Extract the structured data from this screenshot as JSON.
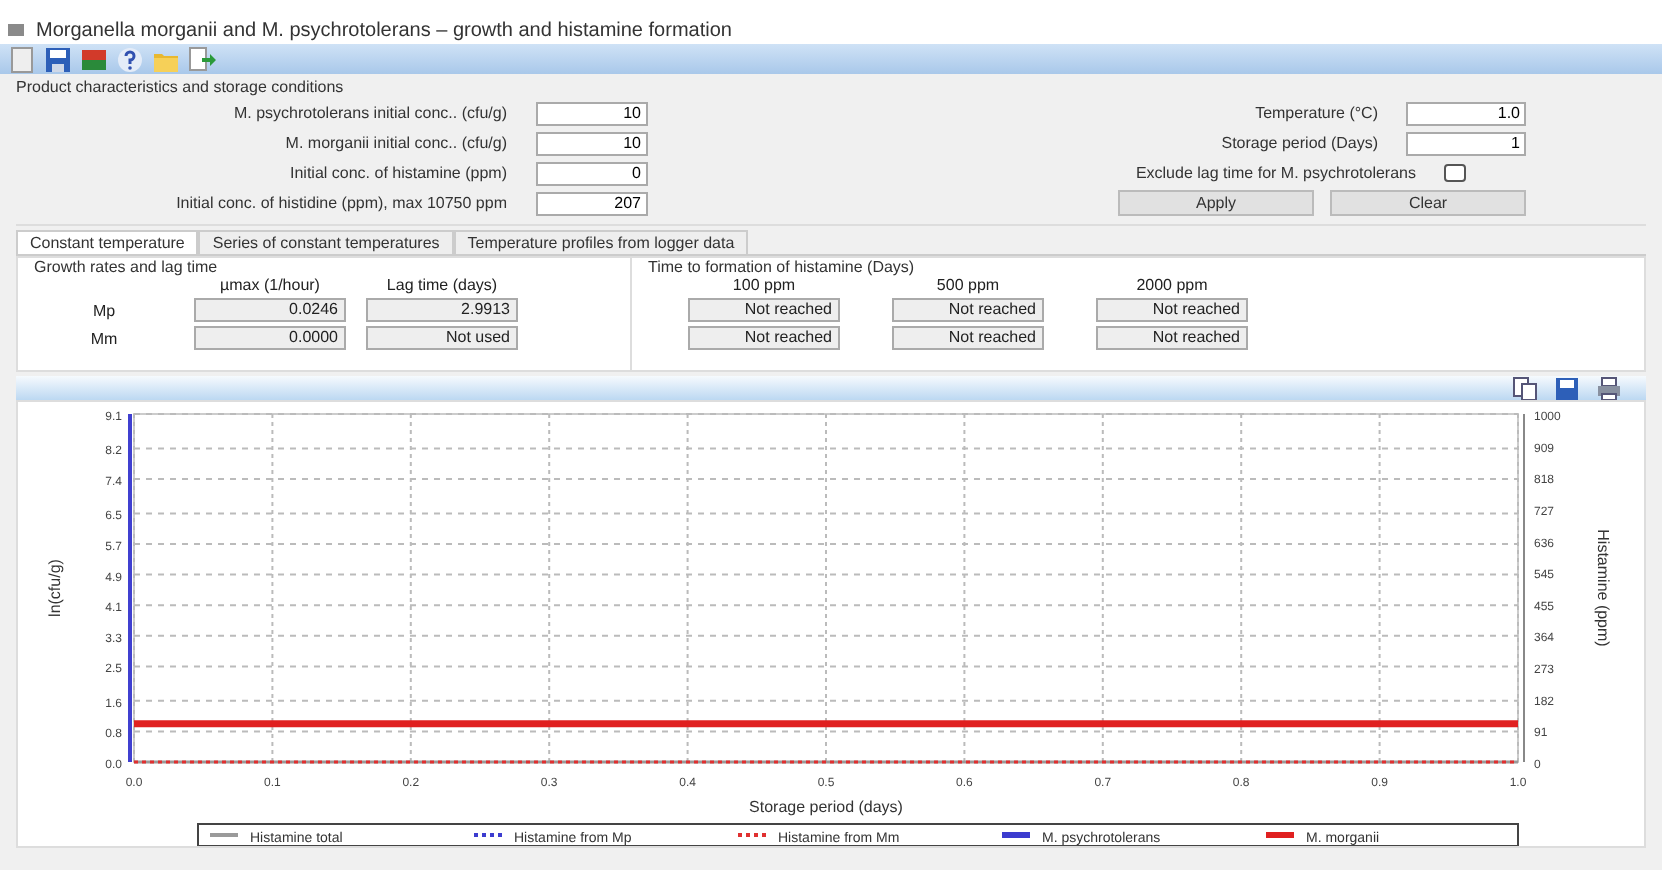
{
  "window": {
    "title": "Morganella morganii and M. psychrotolerans – growth and histamine formation"
  },
  "product_group": {
    "title": "Product characteristics and storage conditions",
    "left_fields": [
      {
        "label": "M. psychrotolerans initial conc.. (cfu/g)",
        "value": "10"
      },
      {
        "label": "M. morganii initial conc.. (cfu/g)",
        "value": "10"
      },
      {
        "label": "Initial conc. of histamine (ppm)",
        "value": "0"
      },
      {
        "label": "Initial conc. of histidine (ppm), max 10750 ppm",
        "value": "207"
      }
    ],
    "right_fields": [
      {
        "label": "Temperature (°C)",
        "value": "1.0"
      },
      {
        "label": "Storage period (Days)",
        "value": "1"
      }
    ],
    "checkbox": {
      "label": "Exclude lag time for M. psychrotolerans",
      "checked": false
    },
    "buttons": [
      "Apply",
      "Clear"
    ]
  },
  "tabs": [
    {
      "label": "Constant temperature",
      "selected": true
    },
    {
      "label": "Series of constant temperatures",
      "selected": false
    },
    {
      "label": "Temperature profiles from logger data",
      "selected": false
    }
  ],
  "growth": {
    "title": "Growth rates and lag time",
    "columns": [
      "µmax (1/hour)",
      "Lag time (days)"
    ],
    "rows": [
      {
        "label": "Mp",
        "values": [
          "0.0246",
          "2.9913"
        ]
      },
      {
        "label": "Mm",
        "values": [
          "0.0000",
          "Not used"
        ]
      }
    ]
  },
  "histamine_time": {
    "title": "Time to formation of histamine  (Days)",
    "columns": [
      "100 ppm",
      "500 ppm",
      "2000 ppm"
    ],
    "rows": [
      [
        "Not reached",
        "Not reached",
        "Not reached"
      ],
      [
        "Not reached",
        "Not reached",
        "Not reached"
      ]
    ]
  },
  "histamine_axis": {
    "title": "Histamine (ppm)",
    "ticks": [
      "1000",
      "909",
      "818",
      "727",
      "636",
      "545",
      "455",
      "364",
      "273",
      "182",
      "91",
      "0"
    ]
  },
  "chart_data": {
    "type": "line",
    "xlabel": "Storage period (days)",
    "ylabel": "ln(cfu/g)",
    "x": [
      0,
      1
    ],
    "xlim": [
      0,
      1
    ],
    "ylim": [
      0,
      9.1
    ],
    "grid": true,
    "legend": true,
    "xticks": [
      {
        "value": 0,
        "label": "0.0"
      },
      {
        "value": 0.1,
        "label": "0.1"
      },
      {
        "value": 0.2,
        "label": "0.2"
      },
      {
        "value": 0.3,
        "label": "0.3"
      },
      {
        "value": 0.4,
        "label": "0.4"
      },
      {
        "value": 0.5,
        "label": "0.5"
      },
      {
        "value": 0.6,
        "label": "0.6"
      },
      {
        "value": 0.7,
        "label": "0.7"
      },
      {
        "value": 0.8,
        "label": "0.8"
      },
      {
        "value": 0.9,
        "label": "0.9"
      },
      {
        "value": 1,
        "label": "1.0"
      }
    ],
    "yticks": [
      {
        "value": 0,
        "label": "0.0"
      },
      0.8,
      1.6,
      2.5,
      3.3,
      4.1,
      4.9,
      5.7,
      6.5,
      7.4,
      8.2,
      9.1
    ],
    "series": [
      {
        "name": "Histamine total",
        "color": "#9a9a9a",
        "line_style": "solid",
        "values": [
          0,
          0
        ]
      },
      {
        "name": "Histamine from Mp",
        "color": "#3c3ccf",
        "line_style": "dotted",
        "values": [
          null,
          null
        ]
      },
      {
        "name": "Histamine from Mm",
        "color": "#e03030",
        "line_style": "dotted",
        "values": [
          0,
          0
        ]
      },
      {
        "name": "M. psychrotolerans",
        "color": "#3c3ccf",
        "line_style": "solid",
        "values": [
          null,
          null
        ]
      },
      {
        "name": "M. morganii",
        "color": "#e02020",
        "line_style": "solid",
        "values": [
          1,
          1
        ]
      }
    ]
  }
}
